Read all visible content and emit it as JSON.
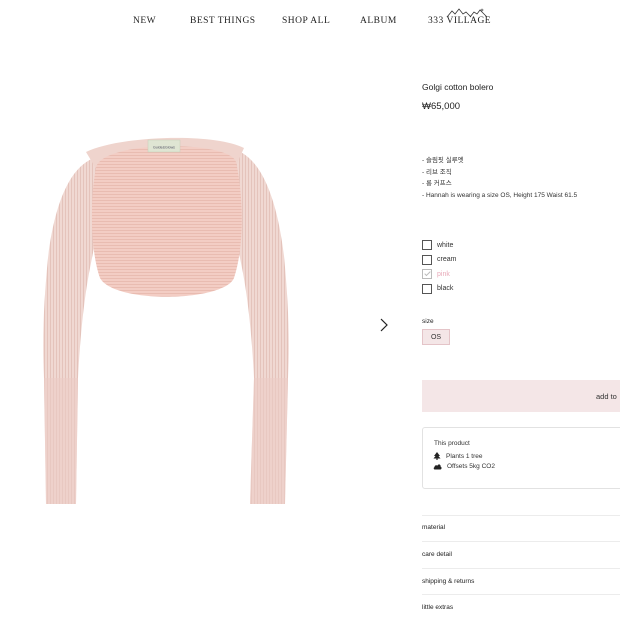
{
  "nav": {
    "items": [
      "NEW",
      "BEST THINGS",
      "SHOP ALL",
      "ALBUM"
    ],
    "village": "333 VILLAGE"
  },
  "product": {
    "tag_text": "Guide&Glows",
    "title": "Golgi cotton bolero",
    "price": "₩65,000",
    "description": [
      "- 슬림핏 실루엣",
      "- 리브 조직",
      "- 롱 커프스",
      "- Hannah is wearing a size OS, Height 175 Waist 61.5"
    ],
    "colors": [
      {
        "label": "white",
        "available": true
      },
      {
        "label": "cream",
        "available": true
      },
      {
        "label": "pink",
        "available": false
      },
      {
        "label": "black",
        "available": true
      }
    ],
    "size_label": "size",
    "size_value": "OS",
    "add_to_cart": "add to"
  },
  "eco": {
    "title": "This product",
    "lines": [
      "Plants 1 tree",
      "Offsets 5kg CO2"
    ]
  },
  "accordion": [
    "material",
    "care detail",
    "shipping & returns",
    "little extras"
  ],
  "colors": {
    "accent_bg": "#f4e6e7",
    "garment": "#f2d2cc",
    "text": "#222222",
    "unavailable": "#e8a9b8"
  }
}
